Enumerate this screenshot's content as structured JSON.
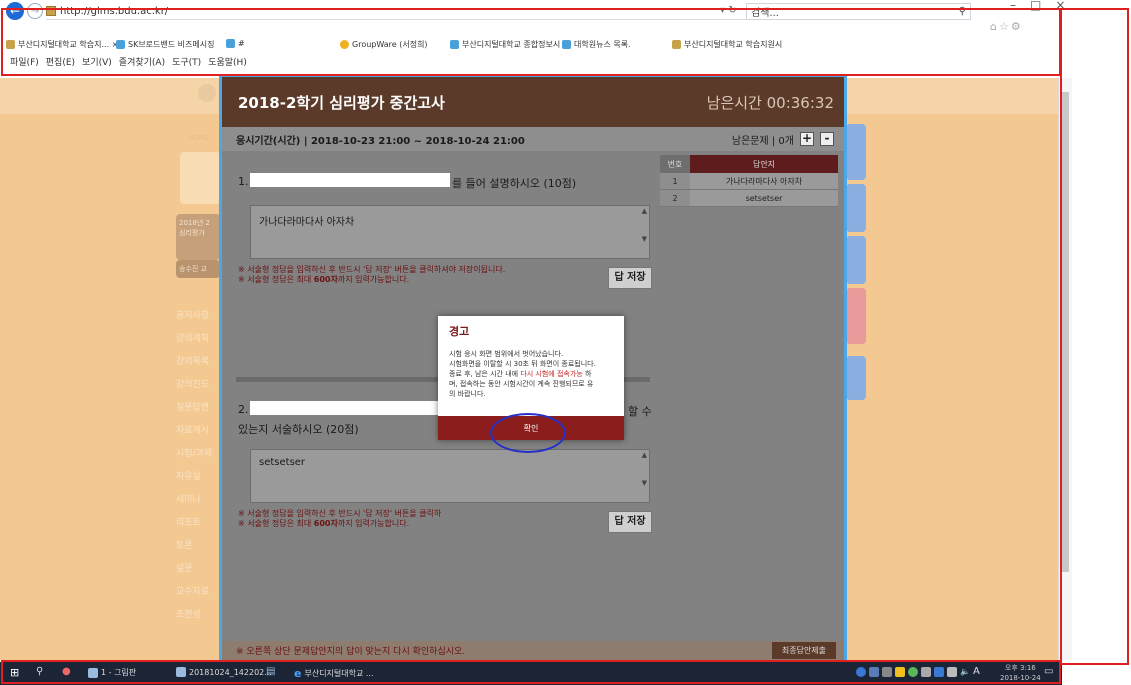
{
  "browser": {
    "url": "http://glms.bdu.ac.kr/",
    "addr_tools": "▾ ↻",
    "search_placeholder": "검색...",
    "favorites": [
      {
        "label": "부산디지털대학교 학습지...  ×",
        "color": "#c8a24a"
      },
      {
        "label": "SK브로드밴드 비즈메시징",
        "color": "#4aa0d8"
      },
      {
        "label": "#",
        "color": "#4aa0d8"
      },
      {
        "label": "GroupWare (서정희)",
        "color": "#f0b020"
      },
      {
        "label": "부산디지털대학교 종합정보시",
        "color": "#4aa0d8"
      },
      {
        "label": "대학원뉴스 목록.",
        "color": "#4aa0d8"
      },
      {
        "label": "부산디지털대학교 학습지원시",
        "color": "#c8a24a"
      }
    ],
    "menu": [
      "파일(F)",
      "편집(E)",
      "보기(V)",
      "즐겨찾기(A)",
      "도구(T)",
      "도움말(H)"
    ]
  },
  "background": {
    "side_items": [
      "공지사항",
      "강의계획",
      "강의목록",
      "강의진도",
      "질문답변",
      "자료게시",
      "시험/과제",
      "자유실",
      "세미나",
      "리포트",
      "토론",
      "설문",
      "교수자료",
      "조편성"
    ],
    "side_box_text": [
      "2018년 2",
      "심리평가",
      "송수진 교"
    ],
    "home_label": "HOME"
  },
  "exam": {
    "title": "2018-2학기 심리평가 중간고사",
    "timer": "남은시간 00:36:32",
    "period": "응시기간(시간) | 2018-10-23 21:00 ~ 2018-10-24 21:00",
    "remaining_label": "남은문제 | 0개",
    "zoom_in": "+",
    "zoom_out": "-",
    "questions": [
      {
        "num": "1.",
        "text_tail": "를 들어 설명하시오 (10점)",
        "answer": "가나다라마다사 아자차"
      },
      {
        "num": "2.",
        "text_tail": "할 수",
        "text_line2": "있는지 서술하시오 (20점)",
        "answer": "setsetser"
      }
    ],
    "note_line1": "※ 서술형 정답을 입력하신 후 반드시 '답 저장' 버튼을 클릭하셔야 저장이됩니다.",
    "note_line2_pre": "※ 서술형 정답은 최대 ",
    "note_line2_bold": "600자",
    "note_line2_post": "까지 입력가능합니다.",
    "note2_line1": "※ 서술형 정답을 입력하신 후 반드시 '답 저장' 버튼을 클릭하",
    "save_label": "답 저장",
    "sheet": {
      "col_num": "번호",
      "col_ans": "답안지",
      "rows": [
        {
          "num": "1",
          "ans": "가나다라마다사 아자차"
        },
        {
          "num": "2",
          "ans": "setsetser"
        }
      ]
    },
    "footer_note": "※ 오른쪽 상단 문제답안지의 답이 맞는지 다시 확인하십시오.",
    "final_submit": "최종답안제출"
  },
  "dialog": {
    "title": "경고",
    "line1": "시험 응시 화면 범위에서 벗어났습니다.",
    "line2": "시험화면을 이탈할 시 30초 뒤 화면이 종료됩니다.",
    "line3_pre": "종료 후, 남은 시간 내에 ",
    "line3_hl": "다시 시험에 접속가능",
    "line3_post": " 하",
    "line4": "며, 접속하는 동안 시험시간이 계속 진행되므로 유",
    "line5": "의 바랍니다.",
    "confirm": "확인"
  },
  "taskbar": {
    "items": [
      "1 - 그림판",
      "20181024_142202...",
      "부산디지털대학교 ..."
    ],
    "ime": "A",
    "time": "오후 3:16",
    "date": "2018-10-24"
  },
  "colors": {
    "header_brown": "#5b3a29",
    "sheet_header": "#5e1c1c",
    "dialog_button": "#8b1d1d",
    "annotation_red": "#e02020",
    "annotation_blue": "#2330c8",
    "window_border": "#4ba6ea"
  }
}
